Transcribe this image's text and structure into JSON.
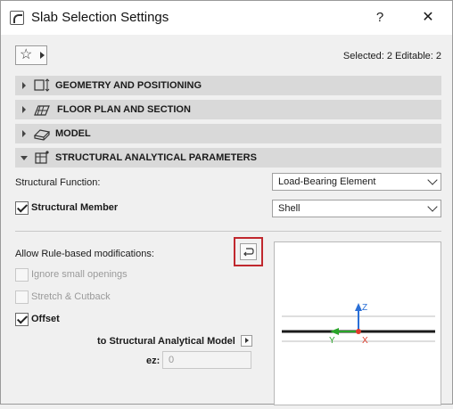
{
  "window": {
    "title": "Slab Selection Settings",
    "help_label": "?",
    "close_label": "✕"
  },
  "toolbar": {
    "favorites_icon": "star-icon",
    "selection_info": "Selected: 2 Editable: 2"
  },
  "panels": [
    {
      "label": "GEOMETRY AND POSITIONING",
      "icon": "geometry-icon",
      "expanded": false
    },
    {
      "label": "FLOOR PLAN AND SECTION",
      "icon": "floor-plan-icon",
      "expanded": false
    },
    {
      "label": "MODEL",
      "icon": "model-icon",
      "expanded": false
    },
    {
      "label": "STRUCTURAL ANALYTICAL PARAMETERS",
      "icon": "structural-icon",
      "expanded": true
    }
  ],
  "structural": {
    "function_label": "Structural Function:",
    "function_value": "Load-Bearing Element",
    "member_label": "Structural Member",
    "member_checked": true,
    "member_value": "Shell",
    "rule_label": "Allow Rule-based modifications:",
    "rule_button_icon": "return-arrow-icon",
    "ignore_openings_label": "Ignore small openings",
    "stretch_label": "Stretch & Cutback",
    "offset_label": "Offset",
    "offset_checked": true,
    "target_label": "to Structural Analytical Model",
    "ez_label": "ez:",
    "ez_value": "0"
  },
  "preview": {
    "z_label": "Z",
    "y_label": "Y",
    "x_label": "X",
    "colors": {
      "z": "#2a6fd6",
      "y": "#2aa52a",
      "x": "#e03a2a",
      "slab": "#1a1a1a"
    }
  }
}
